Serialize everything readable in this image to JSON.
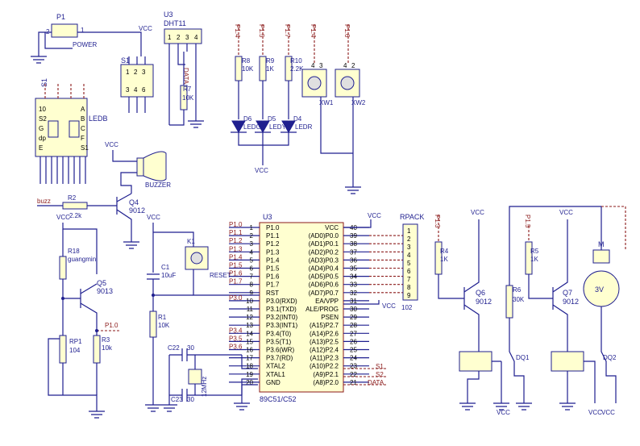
{
  "power": {
    "ref": "P1",
    "name": "POWER",
    "pin1": "1",
    "pin2": "2",
    "vcc": "VCC"
  },
  "switch_s1": {
    "ref": "S1",
    "pins_top": [
      "1",
      "2",
      "3"
    ],
    "pins_bot": [
      "3",
      "4",
      "6"
    ]
  },
  "dht11": {
    "ref": "U3",
    "part": "DHT11",
    "pins": [
      "1",
      "2",
      "3",
      "4"
    ],
    "data": "DATA",
    "r_ref": "R7",
    "r_val": "10K"
  },
  "ledb": {
    "ref": "S1",
    "name": "LEDB",
    "seg_left": [
      "10",
      "S2",
      "G",
      "dp",
      "E",
      "D"
    ],
    "seg_right": [
      "A",
      "B",
      "C",
      "F",
      "S1"
    ],
    "pins_bot": [
      "G",
      "F",
      "E",
      "D",
      "C",
      "B",
      "A",
      "S1",
      "S2"
    ]
  },
  "buzzer": {
    "name": "BUZZER",
    "vcc": "VCC"
  },
  "q4": {
    "ref": "Q4",
    "part": "9012",
    "r_ref": "R2",
    "r_val": "2.2k",
    "net": "buzz"
  },
  "r18": {
    "ref": "R18",
    "name": "guangmin",
    "vcc": "VCC"
  },
  "q5": {
    "ref": "Q5",
    "part": "9013"
  },
  "rp1": {
    "ref": "RP1",
    "val": "104"
  },
  "r3": {
    "ref": "R3",
    "val": "10k",
    "net": "P1.0"
  },
  "leds": {
    "nets": [
      "P1.4",
      "P1.5",
      "P1.7"
    ],
    "resistors": [
      {
        "ref": "R8",
        "val": "10K"
      },
      {
        "ref": "R9",
        "val": "1K"
      },
      {
        "ref": "R10",
        "val": "2.2K"
      }
    ],
    "diodes": [
      "D6",
      "D5",
      "D4"
    ],
    "labels": [
      "LEDG",
      "LEDY",
      "LEDR"
    ],
    "vcc": "VCC"
  },
  "keys": {
    "nets": [
      "P1.4",
      "P1.6"
    ],
    "refs": [
      "XW1",
      "XW2"
    ],
    "pins": [
      "4",
      "3",
      "4",
      "2"
    ]
  },
  "reset": {
    "ref": "K1",
    "label": "RESET",
    "c_ref": "C1",
    "c_val": "10uF",
    "r_ref": "R1",
    "r_val": "10K",
    "vcc": "VCC"
  },
  "crystal": {
    "c22": "C22",
    "c23": "C23",
    "c_val": "30",
    "xtal": "12MHz"
  },
  "mcu": {
    "ref": "U3",
    "part": "89C51/C52",
    "left": [
      {
        "n": "1",
        "name": "P1.0"
      },
      {
        "n": "2",
        "name": "P1.1"
      },
      {
        "n": "3",
        "name": "P1.2"
      },
      {
        "n": "4",
        "name": "P1.3"
      },
      {
        "n": "5",
        "name": "P1.4"
      },
      {
        "n": "6",
        "name": "P1.5"
      },
      {
        "n": "7",
        "name": "P1.6"
      },
      {
        "n": "8",
        "name": "P1.7"
      },
      {
        "n": "9",
        "name": "RST"
      },
      {
        "n": "10",
        "name": "P3.0(RXD)"
      },
      {
        "n": "11",
        "name": "P3.1(TXD)"
      },
      {
        "n": "12",
        "name": "P3.2(INT0)"
      },
      {
        "n": "13",
        "name": "P3.3(INT1)"
      },
      {
        "n": "14",
        "name": "P3.4(T0)"
      },
      {
        "n": "15",
        "name": "P3.5(T1)"
      },
      {
        "n": "16",
        "name": "P3.6(WR)"
      },
      {
        "n": "17",
        "name": "P3.7(RD)"
      },
      {
        "n": "18",
        "name": "XTAL2"
      },
      {
        "n": "19",
        "name": "XTAL1"
      },
      {
        "n": "20",
        "name": "GND"
      }
    ],
    "right": [
      {
        "n": "40",
        "name": "VCC"
      },
      {
        "n": "39",
        "name": "(AD0)P0.0"
      },
      {
        "n": "38",
        "name": "(AD1)P0.1"
      },
      {
        "n": "37",
        "name": "(AD2)P0.2"
      },
      {
        "n": "36",
        "name": "(AD3)P0.3"
      },
      {
        "n": "35",
        "name": "(AD4)P0.4"
      },
      {
        "n": "34",
        "name": "(AD5)P0.5"
      },
      {
        "n": "33",
        "name": "(AD6)P0.6"
      },
      {
        "n": "32",
        "name": "(AD7)P0.7"
      },
      {
        "n": "31",
        "name": "EA/VPP"
      },
      {
        "n": "30",
        "name": "ALE/PROG"
      },
      {
        "n": "29",
        "name": "PSEN"
      },
      {
        "n": "28",
        "name": "(A15)P2.7"
      },
      {
        "n": "27",
        "name": "(A14)P2.6"
      },
      {
        "n": "26",
        "name": "(A13)P2.5"
      },
      {
        "n": "25",
        "name": "(A12)P2.4"
      },
      {
        "n": "24",
        "name": "(A11)P2.3"
      },
      {
        "n": "23",
        "name": "(A10)P2.2"
      },
      {
        "n": "22",
        "name": "(A9)P2.1"
      },
      {
        "n": "21",
        "name": "(A8)P2.0"
      }
    ],
    "left_nets": [
      "P1.0",
      "P1.1",
      "P1.2",
      "P1.3",
      "P1.4",
      "P1.5",
      "P1.6",
      "P1.7",
      "",
      "P3.0",
      "",
      "",
      "",
      "P3.4",
      "P3.5",
      "P3.6",
      "",
      "",
      "",
      ""
    ],
    "right_nets": [
      "S1",
      "S2",
      "DATA"
    ],
    "vcc": "VCC"
  },
  "rpack": {
    "name": "RPACK",
    "part": "102",
    "pins": [
      "1",
      "2",
      "3",
      "4",
      "5",
      "6",
      "7",
      "8",
      "9"
    ],
    "vcc": "VCC"
  },
  "relay1": {
    "r_ref": "R4",
    "r_val": "1K",
    "q_ref": "Q6",
    "q_part": "9012",
    "r6": "R6",
    "r6_val": "30K",
    "dq": "DQ1",
    "net": "P1.3",
    "vcc": "VCC"
  },
  "relay2": {
    "r_ref": "R5",
    "r_val": "1K",
    "q_ref": "Q7",
    "q_part": "9012",
    "dq": "DQ2",
    "net": "P1.5",
    "vcc": "VCC"
  },
  "motor": {
    "label": "M",
    "voltage": "3V",
    "vcc": "VCC"
  }
}
